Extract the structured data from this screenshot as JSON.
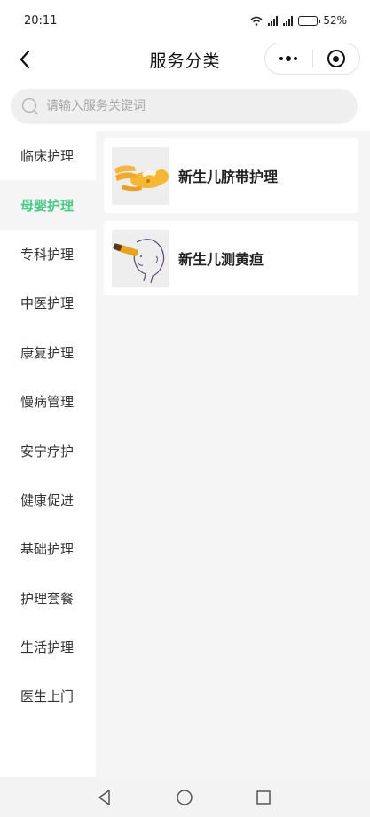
{
  "status_bar": {
    "time": "20:11",
    "battery": "52%",
    "network": "5G",
    "battery_level": 0.52
  },
  "nav": {
    "title": "服务分类",
    "back_icon": "chevron-left-icon",
    "menu_icon": "more-dots-icon",
    "close_icon": "target-icon"
  },
  "search": {
    "placeholder": "请输入服务关键词",
    "value": ""
  },
  "sidebar": {
    "active_index": 1,
    "accent_color": "#4cc98a",
    "items": [
      {
        "label": "临床护理"
      },
      {
        "label": "母婴护理"
      },
      {
        "label": "专科护理"
      },
      {
        "label": "中医护理"
      },
      {
        "label": "康复护理"
      },
      {
        "label": "慢病管理"
      },
      {
        "label": "安宁疗护"
      },
      {
        "label": "健康促进"
      },
      {
        "label": "基础护理"
      },
      {
        "label": "护理套餐"
      },
      {
        "label": "生活护理"
      },
      {
        "label": "医生上门"
      }
    ]
  },
  "services": [
    {
      "label": "新生儿脐带护理",
      "icon": "baby-umbilical-care-image"
    },
    {
      "label": "新生儿测黄疸",
      "icon": "baby-jaundice-test-image"
    }
  ],
  "system_nav": {
    "back_icon": "triangle-back-icon",
    "home_icon": "circle-home-icon",
    "recent_icon": "square-recent-icon"
  }
}
